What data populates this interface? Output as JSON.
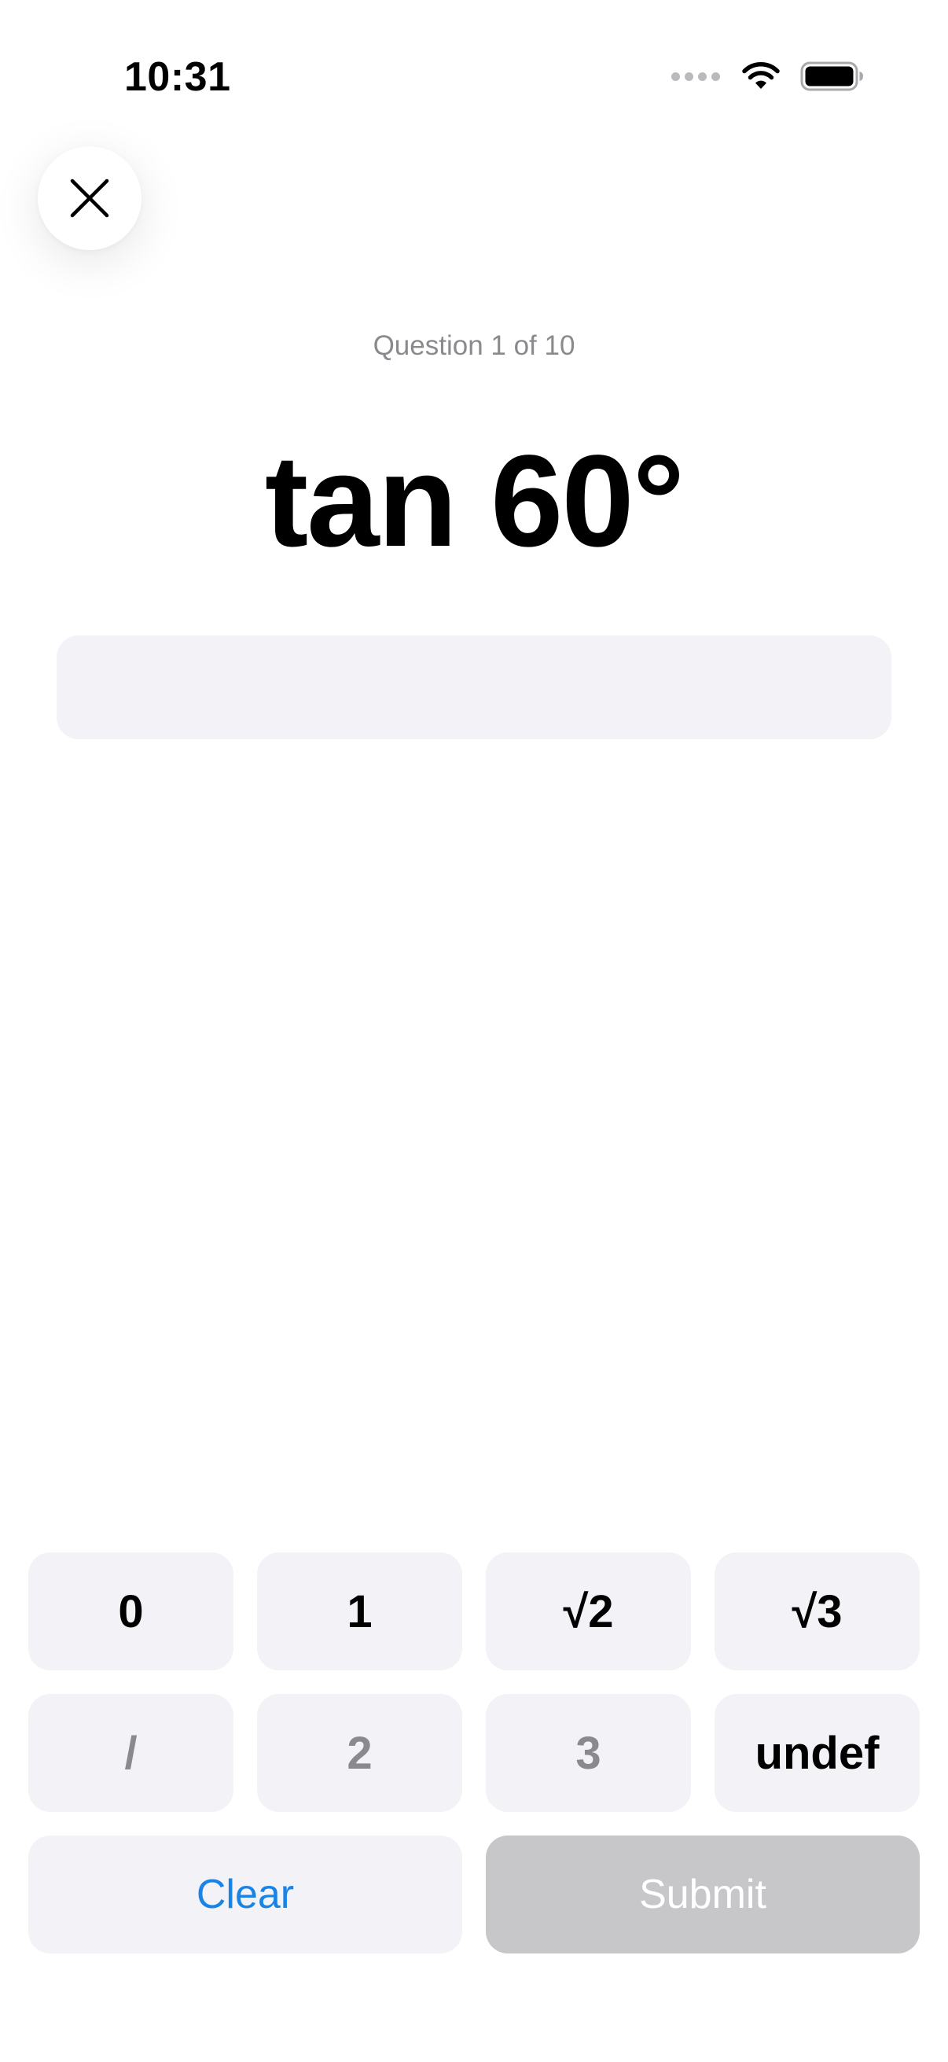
{
  "status_bar": {
    "time": "10:31"
  },
  "close_button": {
    "icon": "close-icon"
  },
  "question": {
    "counter": "Question 1 of 10",
    "prompt": "tan 60°"
  },
  "answer_field": {
    "value": ""
  },
  "keypad": {
    "row1": [
      "0",
      "1",
      "√2",
      "√3"
    ],
    "row2": [
      "/",
      "2",
      "3",
      "undef"
    ],
    "clear_label": "Clear",
    "submit_label": "Submit"
  },
  "colors": {
    "accent": "#1a84e5",
    "key_background": "#f2f2f7",
    "disabled_text": "#8a8a8e",
    "submit_disabled_background": "#c7c7c9"
  }
}
